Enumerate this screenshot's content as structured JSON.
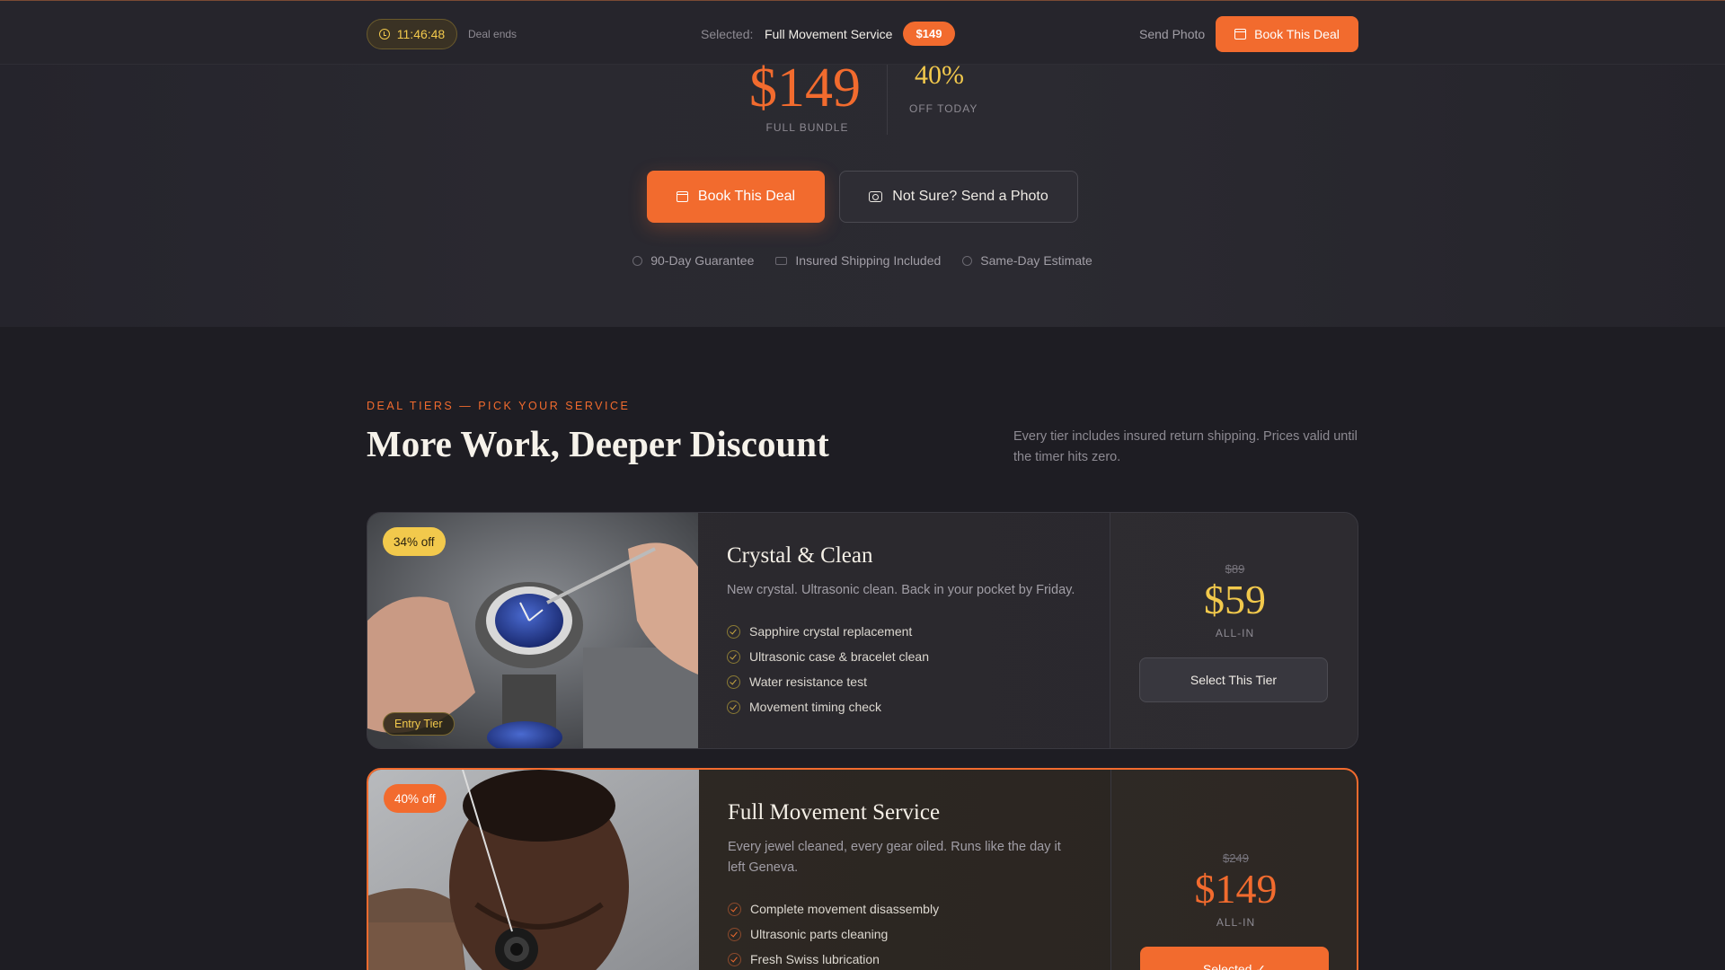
{
  "topbar": {
    "timer": "11:46:48",
    "deal_ends": "Deal ends",
    "selected_label": "Selected:",
    "selected_value": "Full Movement Service",
    "selected_price": "$149",
    "send_photo": "Send Photo",
    "book_label": "Book This Deal"
  },
  "hero": {
    "price": "$149",
    "price_caption": "FULL BUNDLE",
    "percent": "40%",
    "percent_caption": "OFF TODAY",
    "book_label": "Book This Deal",
    "photo_label": "Not Sure? Send a Photo",
    "trust": [
      "90-Day Guarantee",
      "Insured Shipping Included",
      "Same-Day Estimate"
    ]
  },
  "section": {
    "eyebrow": "DEAL TIERS — PICK YOUR SERVICE",
    "title": "More Work, Deeper Discount",
    "note": "Every tier includes insured return shipping. Prices valid until the timer hits zero."
  },
  "tiers": [
    {
      "discount": "34% off",
      "tag": "Entry Tier",
      "name": "Crystal & Clean",
      "desc": "New crystal. Ultrasonic clean. Back in your pocket by Friday.",
      "features": [
        "Sapphire crystal replacement",
        "Ultrasonic case & bracelet clean",
        "Water resistance test",
        "Movement timing check"
      ],
      "old_price": "$89",
      "price": "$59",
      "price_caption": "ALL-IN",
      "button": "Select This Tier"
    },
    {
      "discount": "40% off",
      "name": "Full Movement Service",
      "desc": "Every jewel cleaned, every gear oiled. Runs like the day it left Geneva.",
      "features": [
        "Complete movement disassembly",
        "Ultrasonic parts cleaning",
        "Fresh Swiss lubrication"
      ],
      "old_price": "$249",
      "price": "$149",
      "price_caption": "ALL-IN",
      "button": "Selected ✓"
    }
  ],
  "colors": {
    "accent": "#f26b2e",
    "gold": "#f2c94c",
    "background": "#1f1d24"
  }
}
